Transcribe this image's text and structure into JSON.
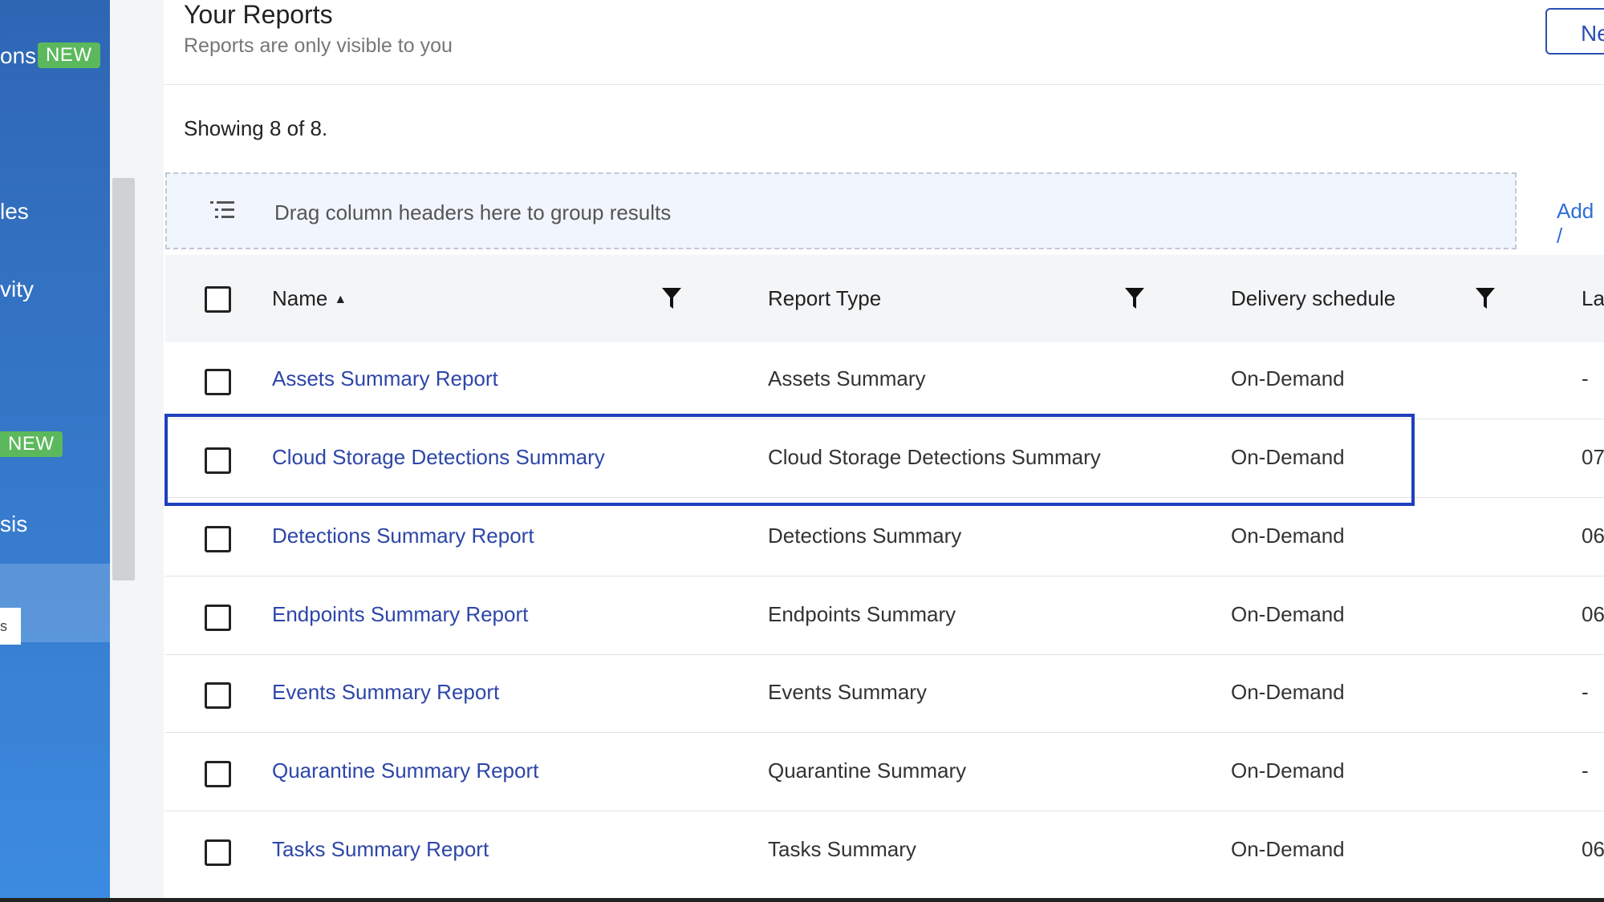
{
  "sidebar": {
    "items": [
      {
        "label": "ons",
        "badge": "NEW"
      },
      {
        "label": "les"
      },
      {
        "label": "vity"
      },
      {
        "label": "",
        "badge": "NEW"
      },
      {
        "label": "sis"
      }
    ],
    "tooltip_text": "s"
  },
  "header": {
    "title": "Your Reports",
    "subtitle": "Reports are only visible to you",
    "new_button_label": "Ne"
  },
  "showing_text": "Showing 8 of 8.",
  "group_bar": {
    "text": "Drag column headers here to group results",
    "add_link": "Add /"
  },
  "table": {
    "columns": {
      "name": "Name",
      "report_type": "Report Type",
      "delivery": "Delivery schedule",
      "last": "La"
    },
    "sort": {
      "column": "name",
      "direction": "ascending"
    },
    "rows": [
      {
        "name": "Assets Summary Report",
        "type": "Assets Summary",
        "delivery": "On-Demand",
        "last": "-"
      },
      {
        "name": "Cloud Storage Detections Summary",
        "type": "Cloud Storage Detections Summary",
        "delivery": "On-Demand",
        "last": "07"
      },
      {
        "name": "Detections Summary Report",
        "type": "Detections Summary",
        "delivery": "On-Demand",
        "last": "06"
      },
      {
        "name": "Endpoints Summary Report",
        "type": "Endpoints Summary",
        "delivery": "On-Demand",
        "last": "06"
      },
      {
        "name": "Events Summary Report",
        "type": "Events Summary",
        "delivery": "On-Demand",
        "last": "-"
      },
      {
        "name": "Quarantine Summary Report",
        "type": "Quarantine Summary",
        "delivery": "On-Demand",
        "last": "-"
      },
      {
        "name": "Tasks Summary Report",
        "type": "Tasks Summary",
        "delivery": "On-Demand",
        "last": "06"
      }
    ],
    "highlighted_row": "Cloud Storage Detections Summary"
  },
  "colors": {
    "sidebar": "#3576c7",
    "badge": "#5cb85c",
    "link": "#2d46a8",
    "highlight_border": "#1e3fbf",
    "group_bar_bg": "#f1f5fd"
  }
}
